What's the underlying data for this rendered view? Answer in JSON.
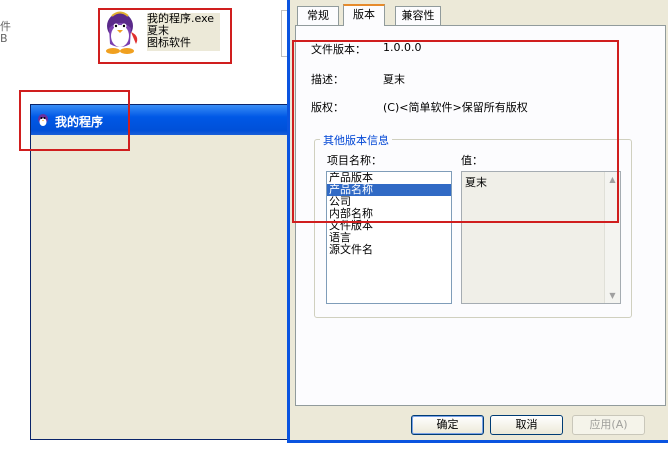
{
  "explorer": {
    "fragment_a": "件",
    "fragment_b": "B",
    "file": {
      "icon": "penguin-icon",
      "name": "我的程序.exe",
      "description": "夏末",
      "company": "图标软件"
    }
  },
  "program_window": {
    "title": "我的程序",
    "icon": "penguin-icon"
  },
  "dialog": {
    "tabs": [
      {
        "label": "常规"
      },
      {
        "label": "版本"
      },
      {
        "label": "兼容性"
      }
    ],
    "active_tab": "版本",
    "fields": {
      "file_version_label": "文件版本：",
      "file_version_value": "1.0.0.0",
      "description_label": "描述：",
      "description_value": "夏末",
      "copyright_label": "版权：",
      "copyright_value": "(C)<简单软件>保留所有版权"
    },
    "other_info": {
      "legend": "其他版本信息",
      "item_name_label": "项目名称：",
      "value_label": "值：",
      "items": [
        {
          "label": "产品版本"
        },
        {
          "label": "产品名称"
        },
        {
          "label": "公司"
        },
        {
          "label": "内部名称"
        },
        {
          "label": "文件版本"
        },
        {
          "label": "语言"
        },
        {
          "label": "源文件名"
        }
      ],
      "selected_item": "产品名称",
      "selected_value": "夏末"
    },
    "buttons": {
      "ok": "确定",
      "cancel": "取消",
      "apply": "应用(A)"
    }
  },
  "colors": {
    "annotation_red": "#d01e1e",
    "title_bar_blue": "#0058e6",
    "selection_blue": "#316ac5",
    "group_legend_blue": "#0046d5"
  }
}
